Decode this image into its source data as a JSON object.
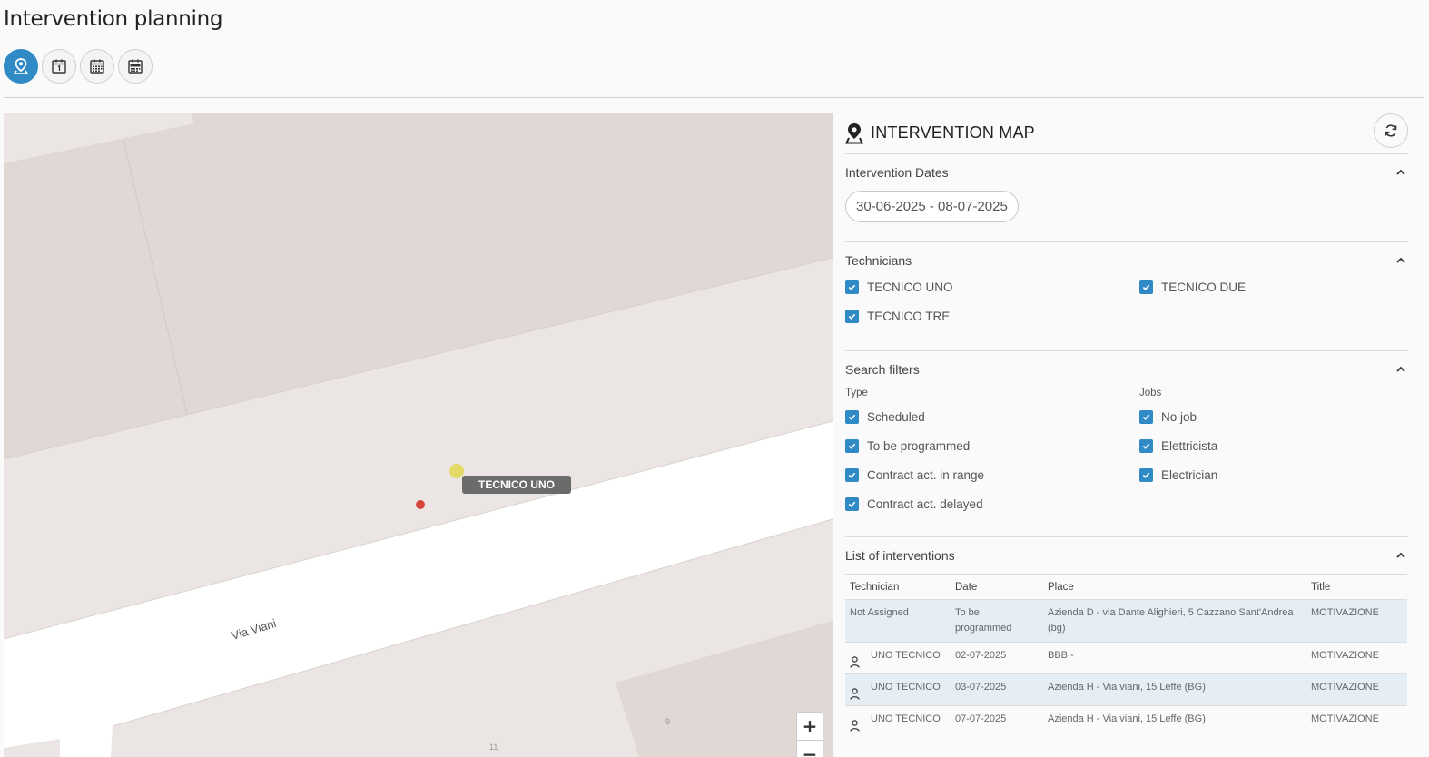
{
  "page": {
    "title": "Intervention planning"
  },
  "view_switch": [
    {
      "name": "map",
      "icon": "map-pin-icon",
      "active": true
    },
    {
      "name": "day",
      "icon": "calendar-day-icon",
      "active": false
    },
    {
      "name": "month",
      "icon": "calendar-grid-icon",
      "active": false
    },
    {
      "name": "year",
      "icon": "calendar-month-icon",
      "active": false
    }
  ],
  "map": {
    "tooltip": "TECNICO UNO",
    "street": "Via Viani",
    "house_numbers": [
      "9",
      "11"
    ],
    "zoom_in": "+",
    "zoom_out": "−"
  },
  "panel": {
    "title": "INTERVENTION MAP",
    "dates": {
      "title": "Intervention Dates",
      "range": "30-06-2025 - 08-07-2025"
    },
    "technicians": {
      "title": "Technicians",
      "items": [
        {
          "label": "TECNICO UNO",
          "checked": true
        },
        {
          "label": "TECNICO DUE",
          "checked": true
        },
        {
          "label": "TECNICO TRE",
          "checked": true
        }
      ]
    },
    "filters": {
      "title": "Search filters",
      "type_label": "Type",
      "jobs_label": "Jobs",
      "types": [
        "Scheduled",
        "To be programmed",
        "Contract act. in range",
        "Contract act. delayed"
      ],
      "jobs": [
        "No job",
        "Elettricista",
        "Electrician"
      ]
    },
    "list": {
      "title": "List of interventions",
      "headers": [
        "Technician",
        "Date",
        "Place",
        "Title"
      ],
      "rows": [
        {
          "technician": "Not Assigned",
          "date": "To be programmed",
          "place": "Azienda D - via Dante Alighieri, 5 Cazzano Sant'Andrea (bg)",
          "title": "MOTIVAZIONE"
        },
        {
          "technician": "UNO TECNICO",
          "date": "02-07-2025",
          "place": "BBB -",
          "title": "MOTIVAZIONE"
        },
        {
          "technician": "UNO TECNICO",
          "date": "03-07-2025",
          "place": "Azienda H - Via viani, 15 Leffe (BG)",
          "title": "MOTIVAZIONE"
        },
        {
          "technician": "UNO TECNICO",
          "date": "07-07-2025",
          "place": "Azienda H - Via viani, 15 Leffe (BG)",
          "title": "MOTIVAZIONE"
        }
      ]
    }
  },
  "colors": {
    "accent": "#2f8ac6",
    "row_highlight": "#e4eef4",
    "marker_red": "#d9443a",
    "marker_yellow": "#e3d85a"
  }
}
